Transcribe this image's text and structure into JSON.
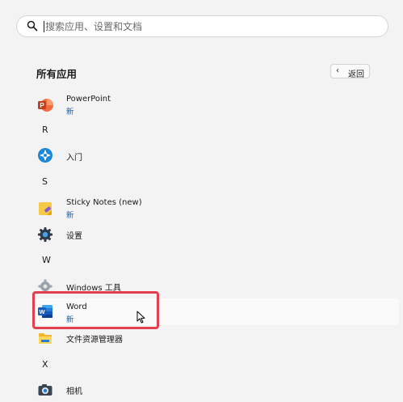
{
  "search": {
    "placeholder": "搜索应用、设置和文档"
  },
  "section": {
    "title": "所有应用",
    "back_label": "返回",
    "back_chevron": "‹"
  },
  "apps": [
    {
      "name": "PowerPoint",
      "badge": "新"
    },
    {
      "name": "入门"
    },
    {
      "name": "Sticky Notes (new)",
      "badge": "新"
    },
    {
      "name": "设置"
    },
    {
      "name": "Windows 工具"
    },
    {
      "name": "Word",
      "badge": "新"
    },
    {
      "name": "文件资源管理器"
    },
    {
      "name": "相机"
    }
  ],
  "letters": [
    "R",
    "S",
    "W",
    "X"
  ],
  "colors": {
    "highlight_border": "#e53e4f",
    "badge": "#1a5fb4",
    "background": "#f3f3f3"
  }
}
